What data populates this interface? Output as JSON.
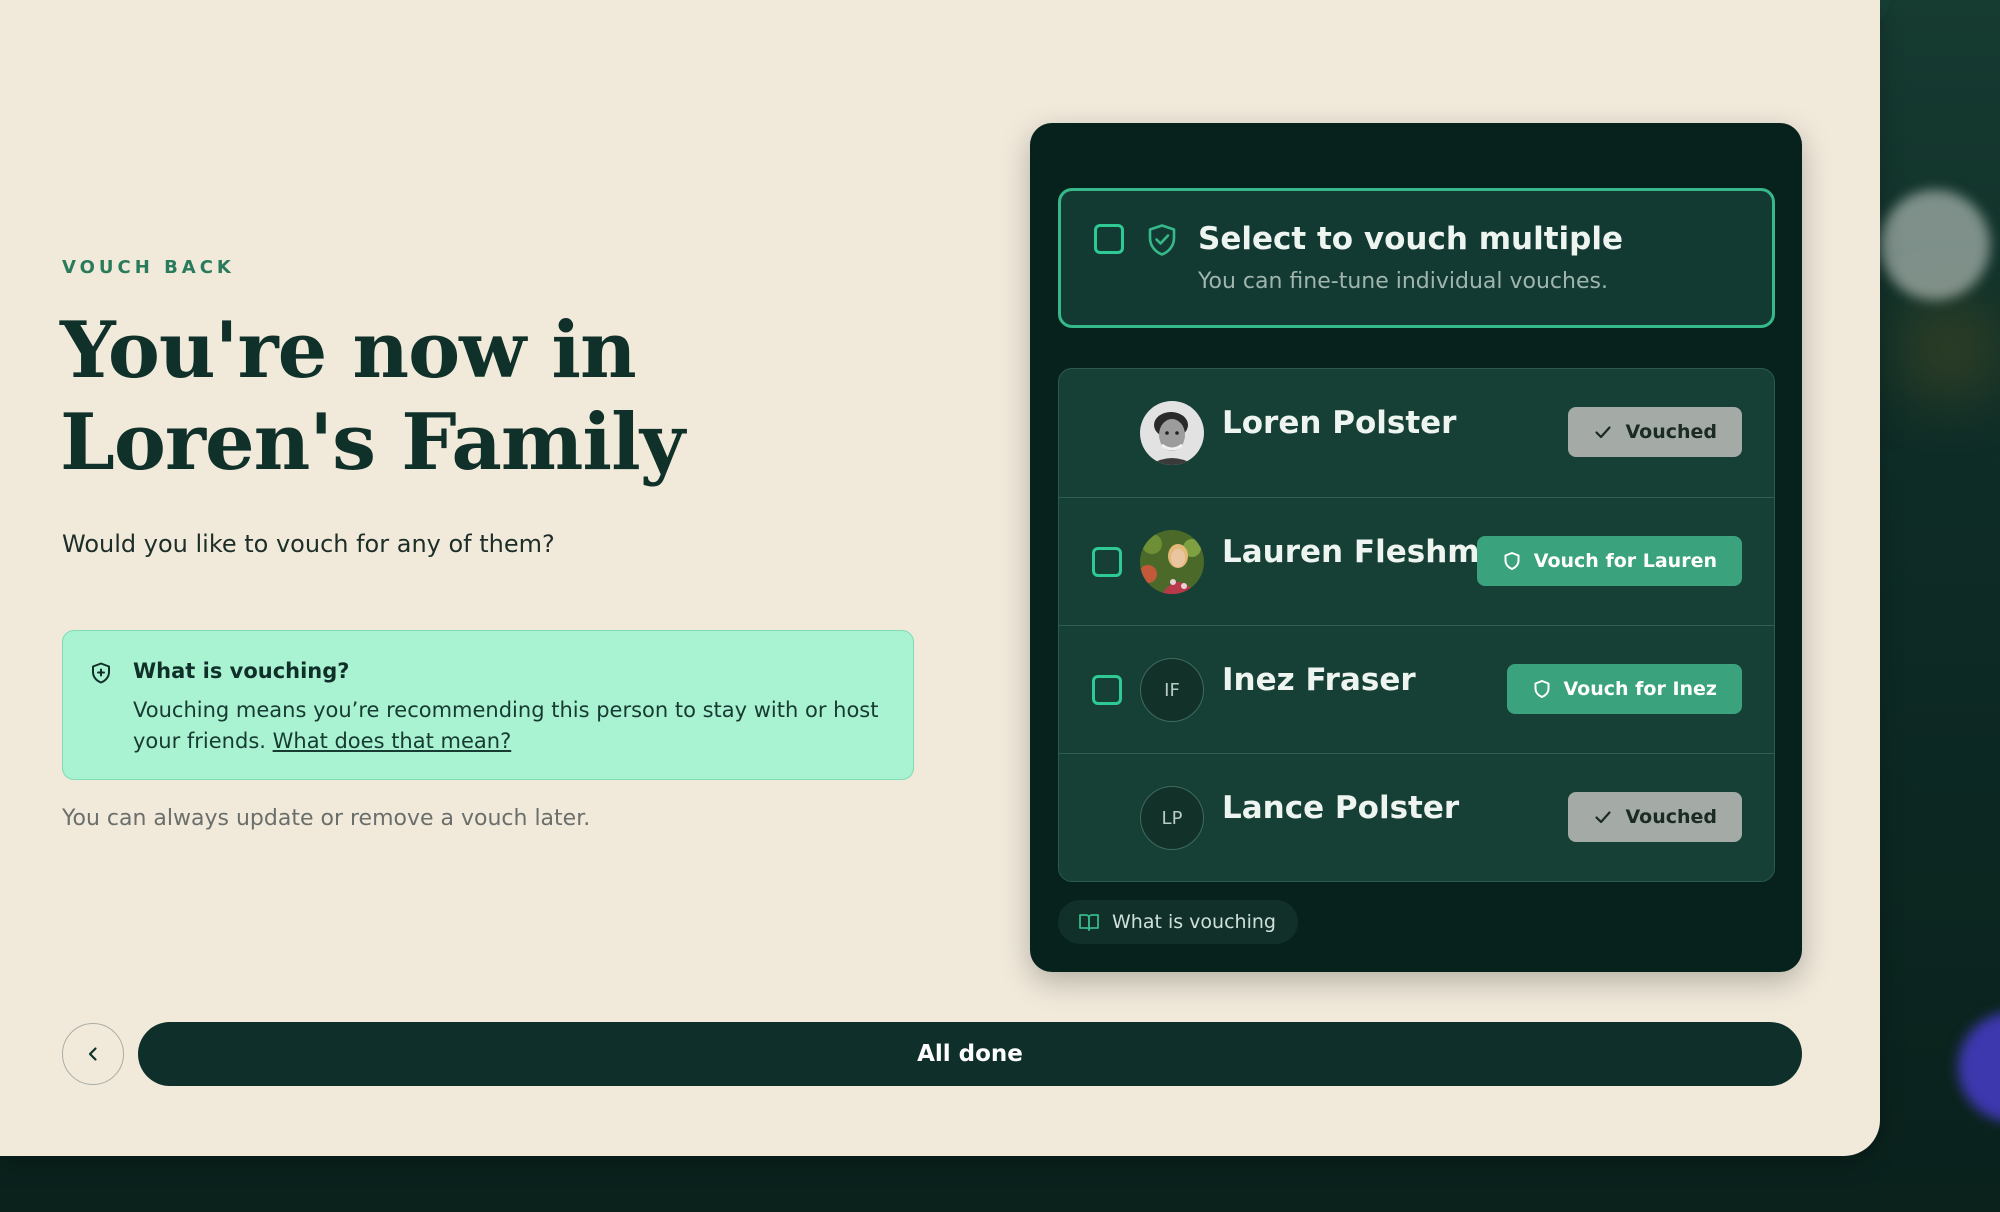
{
  "header": {
    "eyebrow": "VOUCH BACK",
    "title_line1": "You're now in",
    "title_line2": "Loren's Family",
    "subtitle": "Would you like to vouch for any of them?"
  },
  "info": {
    "icon": "shield-plus-icon",
    "title": "What is vouching?",
    "body": "Vouching means you’re recommending this person to stay with or host your friends.",
    "link": "What does that mean?"
  },
  "footnote": "You can always update or remove a vouch later.",
  "select_multiple": {
    "title": "Select to vouch multiple",
    "subtitle": "You can fine-tune individual vouches."
  },
  "members": [
    {
      "name": "Loren Polster",
      "avatar": "photo",
      "action": "Vouched",
      "state": "vouched"
    },
    {
      "name": "Lauren Fleshman",
      "avatar": "photo",
      "action": "Vouch for Lauren",
      "state": "vouch"
    },
    {
      "name": "Inez Fraser",
      "initials": "IF",
      "action": "Vouch for Inez",
      "state": "vouch"
    },
    {
      "name": "Lance Polster",
      "initials": "LP",
      "action": "Vouched",
      "state": "vouched"
    }
  ],
  "help_chip": {
    "icon": "book-open-icon",
    "label": "What is vouching"
  },
  "footer": {
    "back_icon": "chevron-left-icon",
    "done_label": "All done"
  },
  "colors": {
    "page_bg": "#f1eadb",
    "ink": "#10302a",
    "accent": "#37b88a",
    "info_bg": "#a9f2d2",
    "panel_bg": "#07221d",
    "vouch_button": "#3aa27c",
    "vouched_button": "#a4aaa5"
  }
}
